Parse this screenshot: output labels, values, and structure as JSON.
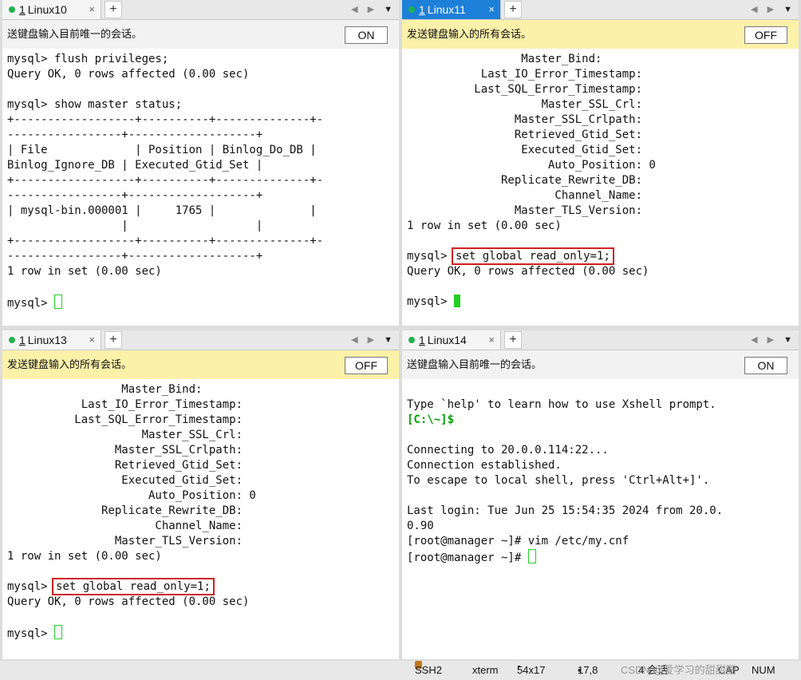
{
  "panes": [
    {
      "tab": {
        "num": "1",
        "name": "Linux10",
        "close": "×"
      },
      "infobar": {
        "text": "送键盘输入目前唯一的会话。",
        "toggle": "ON"
      },
      "lines": [
        "mysql> flush privileges;",
        "Query OK, 0 rows affected (0.00 sec)",
        "",
        "mysql> show master status;",
        "+------------------+----------+--------------+-",
        "-----------------+-------------------+",
        "| File             | Position | Binlog_Do_DB |",
        "Binlog_Ignore_DB | Executed_Gtid_Set |",
        "+------------------+----------+--------------+-",
        "-----------------+-------------------+",
        "| mysql-bin.000001 |     1765 |              |",
        "                 |                   |",
        "+------------------+----------+--------------+-",
        "-----------------+-------------------+",
        "1 row in set (0.00 sec)",
        ""
      ],
      "prompt": "mysql> "
    },
    {
      "tab": {
        "num": "1",
        "name": "Linux11",
        "close": "×"
      },
      "infobar": {
        "text": "发送键盘输入的所有会话。",
        "toggle": "OFF"
      },
      "lines": [
        "                 Master_Bind:",
        "           Last_IO_Error_Timestamp:",
        "          Last_SQL_Error_Timestamp:",
        "                    Master_SSL_Crl:",
        "                Master_SSL_Crlpath:",
        "                Retrieved_Gtid_Set:",
        "                 Executed_Gtid_Set:",
        "                     Auto_Position: 0",
        "              Replicate_Rewrite_DB:",
        "                      Channel_Name:",
        "                Master_TLS_Version:",
        "1 row in set (0.00 sec)",
        ""
      ],
      "cmd_prompt": "mysql> ",
      "cmd": "set global read_only=1;",
      "after": "Query OK, 0 rows affected (0.00 sec)",
      "prompt": "mysql> "
    },
    {
      "tab": {
        "num": "1",
        "name": "Linux13",
        "close": "×"
      },
      "infobar": {
        "text": "发送键盘输入的所有会话。",
        "toggle": "OFF"
      },
      "lines": [
        "                 Master_Bind:",
        "           Last_IO_Error_Timestamp:",
        "          Last_SQL_Error_Timestamp:",
        "                    Master_SSL_Crl:",
        "                Master_SSL_Crlpath:",
        "                Retrieved_Gtid_Set:",
        "                 Executed_Gtid_Set:",
        "                     Auto_Position: 0",
        "              Replicate_Rewrite_DB:",
        "                      Channel_Name:",
        "                Master_TLS_Version:",
        "1 row in set (0.00 sec)",
        ""
      ],
      "cmd_prompt": "mysql> ",
      "cmd": "set global read_only=1;",
      "after": "Query OK, 0 rows affected (0.00 sec)",
      "prompt": "mysql> "
    },
    {
      "tab": {
        "num": "1",
        "name": "Linux14",
        "close": "×"
      },
      "infobar": {
        "text": "送键盘输入目前唯一的会话。",
        "toggle": "ON"
      },
      "lines_before": [
        "",
        "Type `help' to learn how to use Xshell prompt."
      ],
      "local_prompt": "[C:\\~]$",
      "lines_after": [
        "",
        "Connecting to 20.0.0.114:22...",
        "Connection established.",
        "To escape to local shell, press 'Ctrl+Alt+]'.",
        "",
        "Last login: Tue Jun 25 15:54:35 2024 from 20.0.",
        "0.90",
        "[root@manager ~]# vim /etc/my.cnf"
      ],
      "prompt": "[root@manager ~]# "
    }
  ],
  "newtab_label": "+",
  "statusbar": {
    "protocol": "SSH2",
    "term": "xterm",
    "size": "54x17",
    "cursor": "17,8",
    "sessions": "4 会话",
    "cap": "CAP",
    "num": "NUM",
    "watermark": "CSDN @爱学习的甜甜圈"
  },
  "colors": {
    "accent": "#1e7fd8",
    "highlight": "#d01e1e",
    "cursor": "#22d022"
  }
}
